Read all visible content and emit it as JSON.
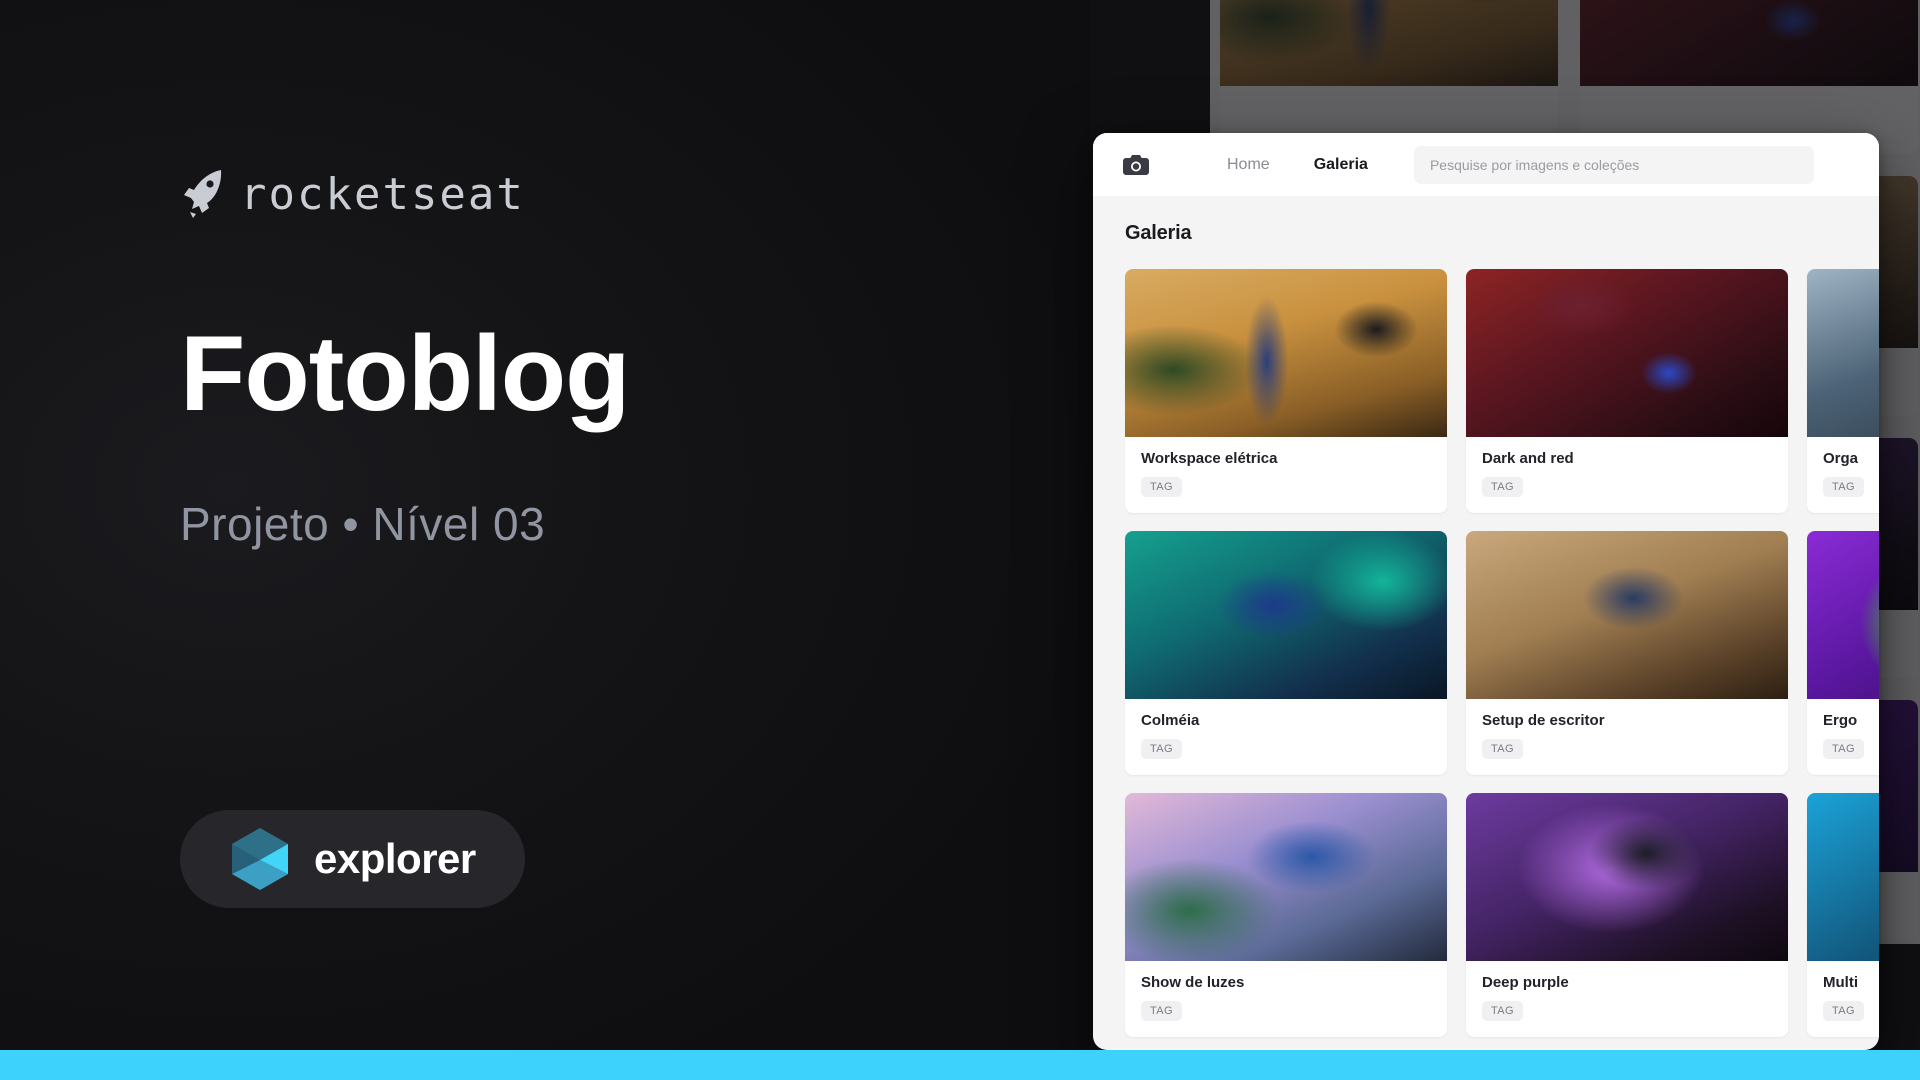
{
  "brand": {
    "name": "rocketseat",
    "icon": "rocket-icon"
  },
  "hero": {
    "title": "Fotoblog",
    "subtitle": "Projeto • Nível 03",
    "badge_label": "explorer",
    "badge_icon": "explorer-cube-icon"
  },
  "colors": {
    "accent_cyan": "#3DD2FB",
    "background_dark": "#141416",
    "badge_bg": "#26262B",
    "subtitle_gray": "#9095A1",
    "app_bg": "#F4F4F5",
    "card_bg": "#FFFFFF",
    "tag_bg": "#F0F0F2",
    "tag_text": "#7B7B84"
  },
  "app": {
    "header": {
      "logo_icon": "camera-icon",
      "nav": [
        {
          "label": "Home",
          "active": false
        },
        {
          "label": "Galeria",
          "active": true
        }
      ],
      "search": {
        "placeholder": "Pesquise por imagens e coleções",
        "value": "",
        "icon": "search-input"
      }
    },
    "page_title": "Galeria",
    "tag_label": "TAG",
    "cards": [
      {
        "title": "Workspace elétrica",
        "tag": "TAG",
        "thumb": "ph-workspace"
      },
      {
        "title": "Dark and red",
        "tag": "TAG",
        "thumb": "ph-darkred"
      },
      {
        "title": "Orga",
        "tag": "TAG",
        "thumb": "ph-orga"
      },
      {
        "title": "Colméia",
        "tag": "TAG",
        "thumb": "ph-colmeia"
      },
      {
        "title": "Setup de escritor",
        "tag": "TAG",
        "thumb": "ph-setup"
      },
      {
        "title": "Ergo",
        "tag": "TAG",
        "thumb": "ph-ergo"
      },
      {
        "title": "Show de luzes",
        "tag": "TAG",
        "thumb": "ph-luzes"
      },
      {
        "title": "Deep purple",
        "tag": "TAG",
        "thumb": "ph-purple"
      },
      {
        "title": "Multi",
        "tag": "TAG",
        "thumb": "ph-multi"
      }
    ]
  }
}
